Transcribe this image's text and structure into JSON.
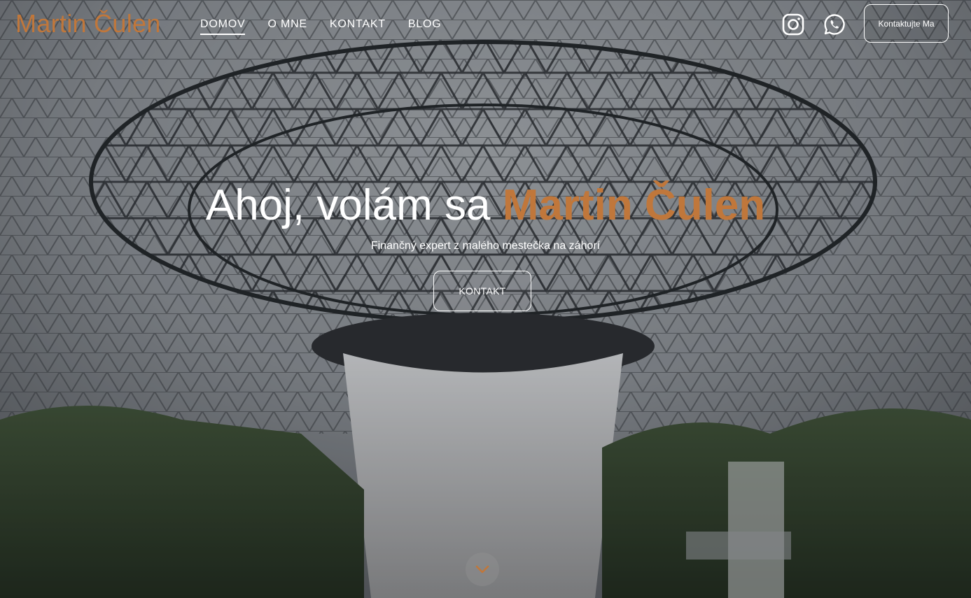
{
  "header": {
    "brand": "Martin Čulen",
    "nav": [
      {
        "label": "DOMOV",
        "active": true
      },
      {
        "label": "O MNE",
        "active": false
      },
      {
        "label": "KONTAKT",
        "active": false
      },
      {
        "label": "BLOG",
        "active": false
      }
    ],
    "social_icons": [
      "instagram-icon",
      "whatsapp-icon"
    ],
    "contact_button": "Kontaktujte Ma"
  },
  "hero": {
    "title_prefix": "Ahoj, volám sa ",
    "title_name": "Martin Čulen",
    "subtitle": "Finančný expert z malého mestečka na záhorí",
    "cta": "KONTAKT",
    "scroll_icon": "chevron-down-icon"
  },
  "colors": {
    "accent": "#c0773b",
    "text": "#ffffff"
  }
}
